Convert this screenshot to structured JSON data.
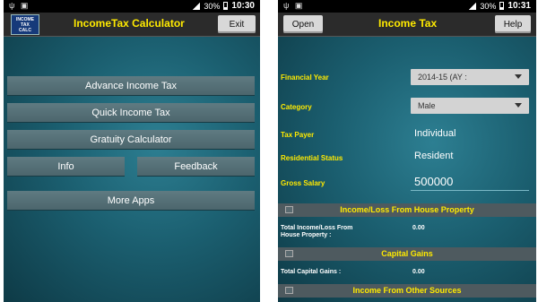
{
  "left": {
    "status": {
      "time": "10:30",
      "battery": "30%",
      "left_icons": "ψ ▣"
    },
    "app_icon_text": [
      "INCOME",
      "TAX",
      "CALC"
    ],
    "title": "IncomeTax Calculator",
    "exit_label": "Exit",
    "menu": {
      "advance": "Advance Income Tax",
      "quick": "Quick Income Tax",
      "gratuity": "Gratuity Calculator",
      "info": "Info",
      "feedback": "Feedback",
      "more_apps": "More Apps"
    }
  },
  "right": {
    "status": {
      "time": "10:31",
      "battery": "30%",
      "left_icons": "ψ ▣"
    },
    "open_label": "Open",
    "title": "Income Tax",
    "help_label": "Help",
    "form": {
      "financial_year": {
        "label": "Financial Year",
        "value": "2014-15 (AY :"
      },
      "category": {
        "label": "Category",
        "value": "Male"
      },
      "tax_payer": {
        "label": "Tax Payer",
        "value": "Individual"
      },
      "residential_status": {
        "label": "Residential Status",
        "value": "Resident"
      },
      "gross_salary": {
        "label": "Gross Salary",
        "value": "500000"
      }
    },
    "sections": {
      "house_property": "Income/Loss From House Property",
      "house_total_label_1": "Total Income/Loss From",
      "house_total_label_2": "House Property :",
      "house_total_value": "0.00",
      "capital_gains": "Capital Gains",
      "capital_total_label": "Total Capital Gains :",
      "capital_total_value": "0.00",
      "other_sources": "Income From Other Sources"
    }
  }
}
